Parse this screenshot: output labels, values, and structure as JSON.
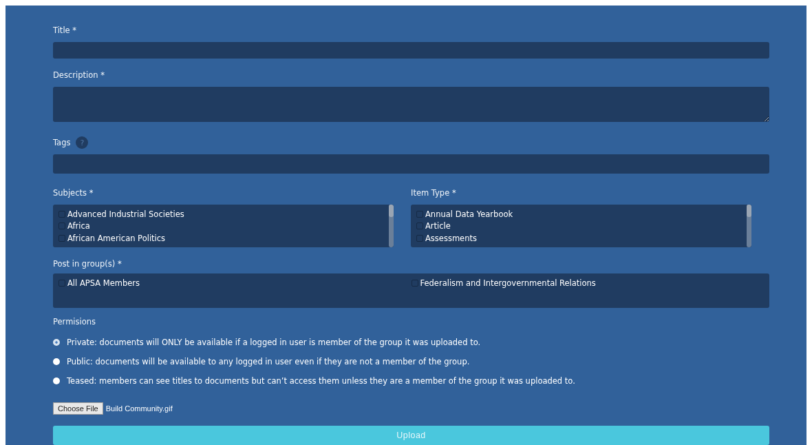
{
  "fields": [
    {
      "kind": "input",
      "label": "Title *"
    },
    {
      "kind": "textarea",
      "label": "Description *"
    },
    {
      "kind": "input",
      "label": "Tags",
      "help": "?"
    }
  ],
  "subjects": {
    "label": "Subjects *",
    "items": [
      {
        "label": "Advanced Industrial Societies",
        "checked": false
      },
      {
        "label": "Africa",
        "checked": false
      },
      {
        "label": "African American Politics",
        "checked": false
      }
    ]
  },
  "item_type": {
    "label": "Item Type *",
    "items": [
      {
        "label": "Annual Data Yearbook",
        "checked": false
      },
      {
        "label": "Article",
        "checked": false
      },
      {
        "label": "Assessments",
        "checked": false
      }
    ]
  },
  "groups": {
    "label": "Post in group(s) *",
    "items": [
      {
        "label": "All APSA Members",
        "checked": false
      },
      {
        "label": "Federalism and Intergovernmental Relations",
        "checked": false
      }
    ]
  },
  "permissions": {
    "label": "Permisions",
    "options": [
      {
        "label": "Private: documents will ONLY be available if a logged in user is member of the group it was uploaded to.",
        "selected": true
      },
      {
        "label": "Public: documents will be available to any logged in user even if they are not a member of the group.",
        "selected": false
      },
      {
        "label": "Teased: members can see titles to documents but can’t access them unless they are a member of the group it was uploaded to.",
        "selected": false
      }
    ]
  },
  "file": {
    "button": "Choose File",
    "name": "Build Community.gif"
  },
  "submit": "Upload"
}
